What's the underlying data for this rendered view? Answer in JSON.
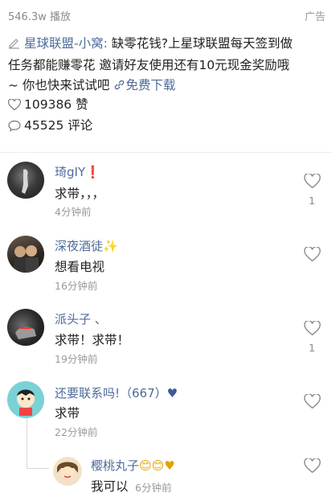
{
  "header": {
    "play_count": "546.3w 播放",
    "ad_label": "广告"
  },
  "post": {
    "author": "星球联盟-小窝:",
    "text_line1": " 缺零花钱?上星球联盟每天签到做",
    "text_line2": "任务都能赚零花  邀请好友使用还有10元现金奖励哦",
    "text_line3_prefix": "~  你也快来试试吧 ",
    "download_label": "免费下载"
  },
  "stats": {
    "likes": "109386 赞",
    "comments": "45525 评论"
  },
  "comments": [
    {
      "user": "琦gIY",
      "badge": "❗",
      "text": "求带，，，",
      "time": "4分钟前",
      "likes": "1"
    },
    {
      "user": "深夜酒徒",
      "badge": "✨",
      "text": "想看电视",
      "time": "16分钟前",
      "likes": ""
    },
    {
      "user": "派头子  、",
      "badge": "",
      "text": "求带！求带！",
      "time": "19分钟前",
      "likes": "1"
    },
    {
      "user": "还要联系吗!（667）",
      "badge": "♥",
      "text": "求带",
      "time": "22分钟前",
      "likes": ""
    }
  ],
  "reply": {
    "user": "樱桃丸子",
    "badge": "😊😊♥",
    "text": "我可以",
    "time": "6分钟前"
  }
}
